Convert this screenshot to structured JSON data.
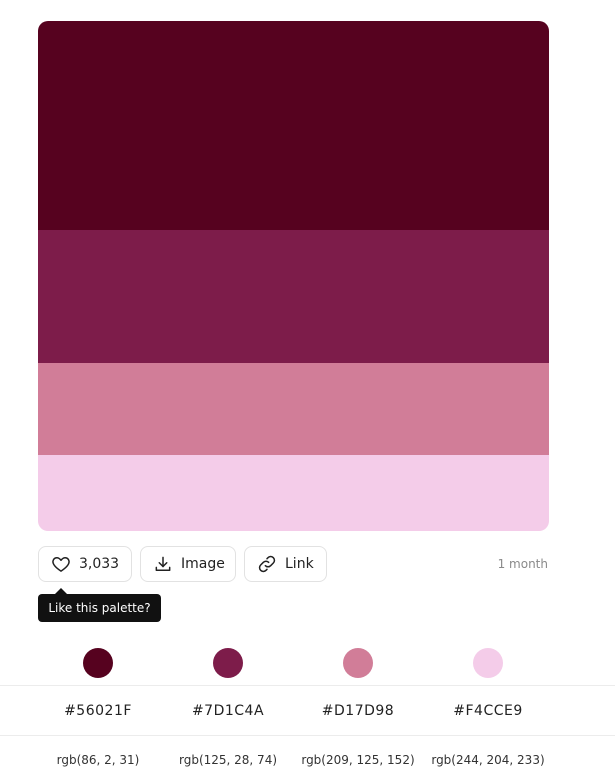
{
  "palette": {
    "colors": [
      {
        "hex": "#56021F",
        "rgb": "rgb(86, 2, 31)"
      },
      {
        "hex": "#7D1C4A",
        "rgb": "rgb(125, 28, 74)"
      },
      {
        "hex": "#D17D98",
        "rgb": "rgb(209, 125, 152)"
      },
      {
        "hex": "#F4CCE9",
        "rgb": "rgb(244, 204, 233)"
      }
    ]
  },
  "actions": {
    "like_count": "3,033",
    "image_label": "Image",
    "link_label": "Link",
    "time_ago": "1 month",
    "tooltip": "Like this palette?"
  },
  "icons": {
    "like": "heart-icon",
    "image": "download-icon",
    "link": "link-icon"
  }
}
